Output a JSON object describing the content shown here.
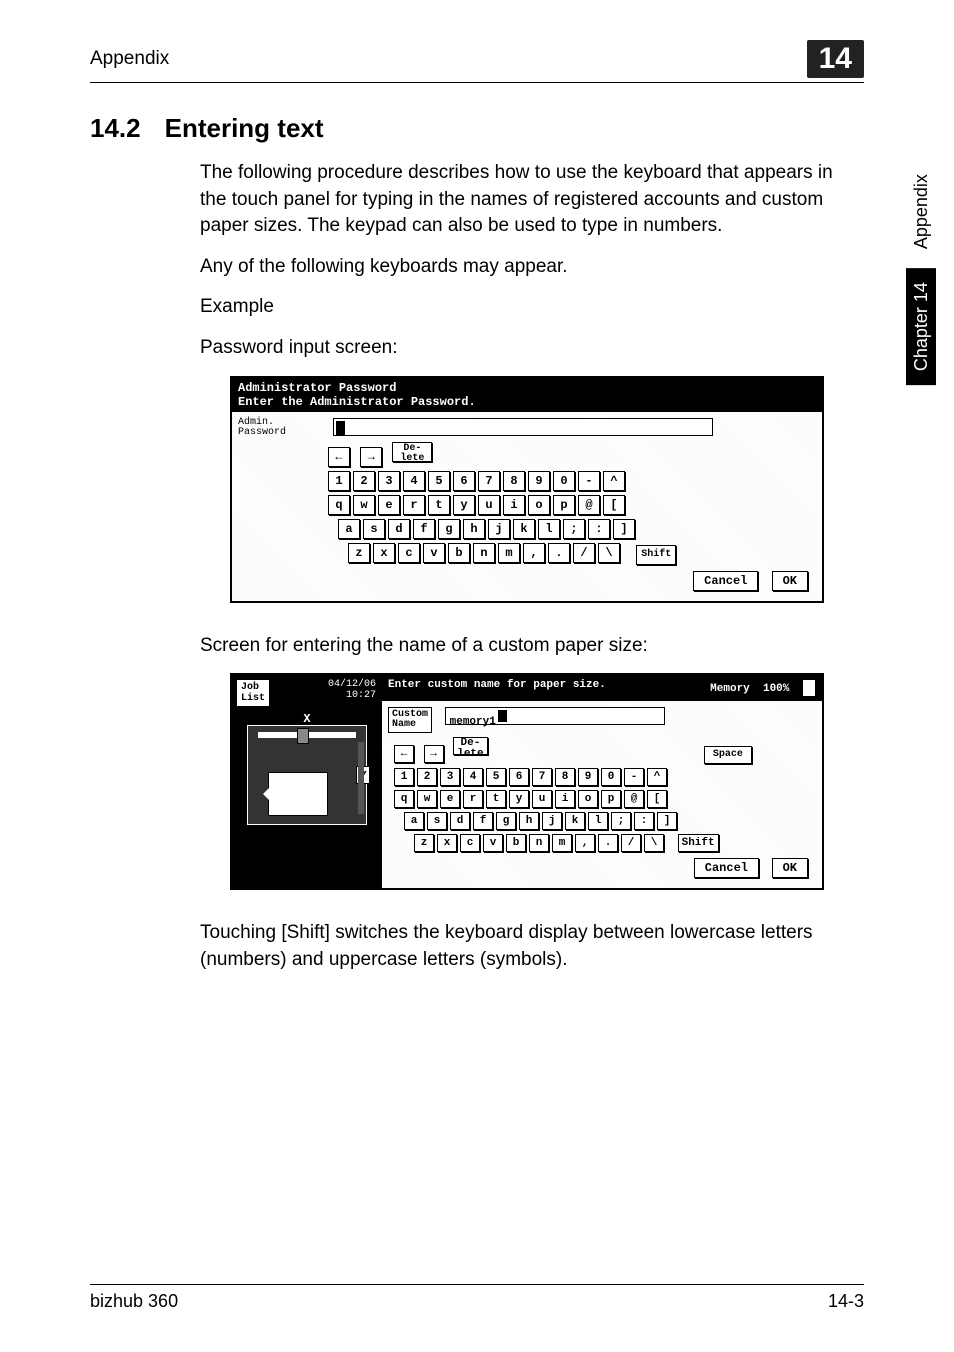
{
  "header": {
    "left": "Appendix",
    "chapter_num": "14"
  },
  "side_tab": {
    "chapter": "Chapter 14",
    "appendix": "Appendix"
  },
  "section": {
    "number": "14.2",
    "title": "Entering text"
  },
  "paragraphs": {
    "p1": "The following procedure describes how to use the keyboard that appears in the touch panel for typing in the names of registered accounts and custom paper sizes. The keypad can also be used to type in numbers.",
    "p2": "Any of the following keyboards may appear.",
    "p3": "Example",
    "p4": "Password input screen:",
    "p5": "Screen for entering the name of a custom paper size:",
    "p6": "Touching [Shift] switches the keyboard display between lowercase letters (numbers) and uppercase letters (symbols)."
  },
  "screenshot1": {
    "title": "Administrator Password",
    "subtitle": "Enter the Administrator Password.",
    "field_label": "Admin.\nPassword",
    "nav": {
      "left": "←",
      "right": "→",
      "delete": "De-\nlete"
    },
    "rows": {
      "r1": [
        "1",
        "2",
        "3",
        "4",
        "5",
        "6",
        "7",
        "8",
        "9",
        "0",
        "-",
        "^"
      ],
      "r2": [
        "q",
        "w",
        "e",
        "r",
        "t",
        "y",
        "u",
        "i",
        "o",
        "p",
        "@",
        "["
      ],
      "r3": [
        "a",
        "s",
        "d",
        "f",
        "g",
        "h",
        "j",
        "k",
        "l",
        ";",
        ":",
        "]"
      ],
      "r4": [
        "z",
        "x",
        "c",
        "v",
        "b",
        "n",
        "m",
        ",",
        ".",
        "/",
        "\\"
      ]
    },
    "shift": "Shift",
    "cancel": "Cancel",
    "ok": "OK"
  },
  "screenshot2": {
    "job_list": "Job\nList",
    "datetime": "04/12/06\n10:27",
    "axis_x": "X",
    "axis_y": "Y",
    "title": "Enter custom name for paper size.",
    "memory_label": "Memory",
    "memory_value": "100%",
    "field_label": "Custom\nName",
    "field_value": "memory1",
    "nav": {
      "left": "←",
      "right": "→",
      "delete": "De-\nlete",
      "space": "Space"
    },
    "rows": {
      "r1": [
        "1",
        "2",
        "3",
        "4",
        "5",
        "6",
        "7",
        "8",
        "9",
        "0",
        "-",
        "^"
      ],
      "r2": [
        "q",
        "w",
        "e",
        "r",
        "t",
        "y",
        "u",
        "i",
        "o",
        "p",
        "@",
        "["
      ],
      "r3": [
        "a",
        "s",
        "d",
        "f",
        "g",
        "h",
        "j",
        "k",
        "l",
        ";",
        ":",
        "]"
      ],
      "r4": [
        "z",
        "x",
        "c",
        "v",
        "b",
        "n",
        "m",
        ",",
        ".",
        "/",
        "\\"
      ]
    },
    "shift": "Shift",
    "cancel": "Cancel",
    "ok": "OK"
  },
  "footer": {
    "left": "bizhub 360",
    "right": "14-3"
  }
}
